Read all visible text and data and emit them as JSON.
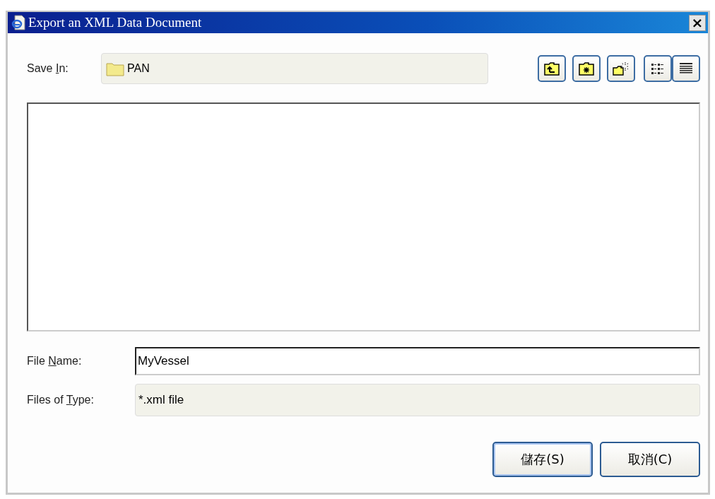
{
  "window": {
    "title": "Export an XML Data Document",
    "close": "×"
  },
  "save_in": {
    "label": {
      "before": "Save ",
      "key": "I",
      "after": "n:"
    },
    "value": "PAN"
  },
  "file_name": {
    "label": {
      "before": "File ",
      "key": "N",
      "after": "ame:"
    },
    "value": "MyVessel"
  },
  "file_type": {
    "label": {
      "before": "Files of ",
      "key": "T",
      "after": "ype:"
    },
    "value": "*.xml file"
  },
  "buttons": [
    {
      "label": "儲存(S)",
      "default": true
    },
    {
      "label": "取消(C)",
      "default": false
    }
  ]
}
